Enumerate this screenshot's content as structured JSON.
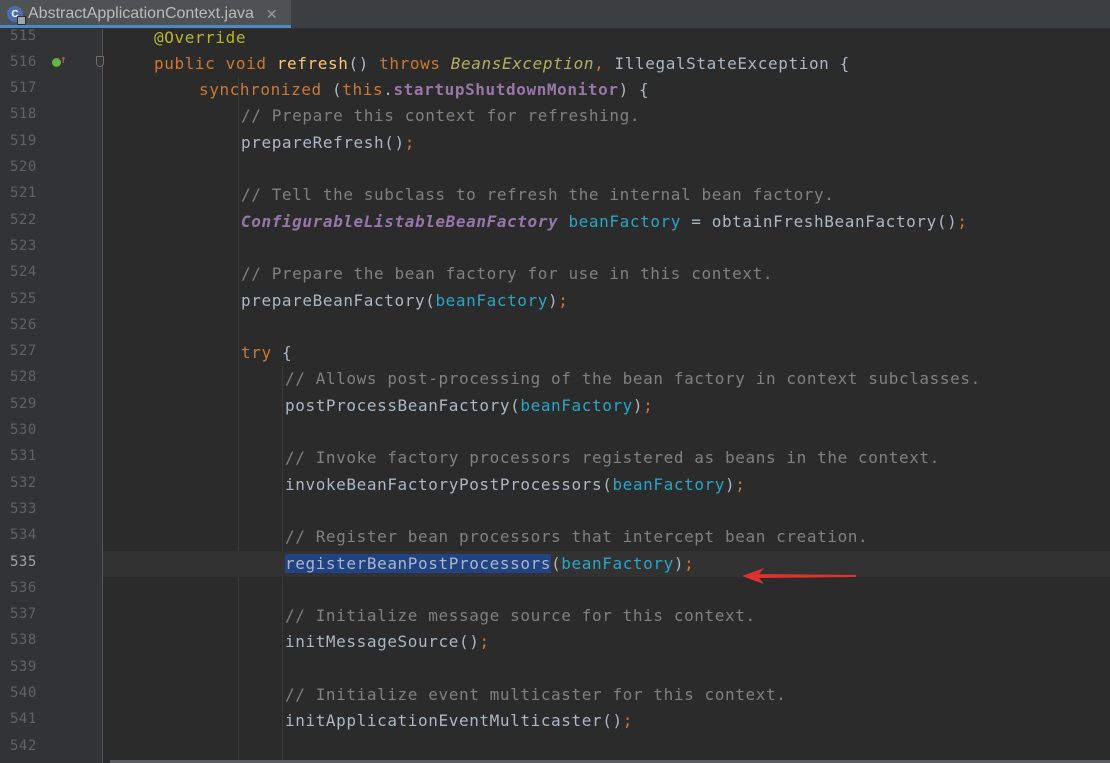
{
  "tab": {
    "title": "AbstractApplicationContext.java",
    "icon_letter": "C",
    "close": "✕"
  },
  "colors": {
    "background": "#2b2b2b",
    "gutter": "#313335",
    "keyword": "#cc7832",
    "annotation": "#bbb529",
    "method": "#ffc66d",
    "field": "#9876aa",
    "variable": "#29a5c5",
    "comment": "#808080",
    "selection": "#214283",
    "arrow": "#e0312f"
  },
  "gutter_icons": {
    "line_516": [
      "override-marker-icon",
      "override-arrow-icon",
      "fold-marker-icon"
    ]
  },
  "lines": [
    {
      "num": "515",
      "tokens": [
        {
          "t": "@Override",
          "c": "ann"
        }
      ]
    },
    {
      "num": "516",
      "tokens": [
        {
          "t": "public ",
          "c": "kw"
        },
        {
          "t": "void ",
          "c": "kw"
        },
        {
          "t": "refresh",
          "c": "fn"
        },
        {
          "t": "() "
        },
        {
          "t": "throws ",
          "c": "kw"
        },
        {
          "t": "BeansException",
          "c": "exc"
        },
        {
          "t": ", ",
          "c": "kw"
        },
        {
          "t": "IllegalStateException {"
        }
      ]
    },
    {
      "num": "517",
      "tokens": [
        {
          "t": "synchronized ",
          "c": "kw"
        },
        {
          "t": "("
        },
        {
          "t": "this",
          "c": "kw"
        },
        {
          "t": "."
        },
        {
          "t": "startupShutdownMonitor",
          "c": "fld"
        },
        {
          "t": ") {"
        }
      ]
    },
    {
      "num": "518",
      "tokens": [
        {
          "t": "// Prepare this context for refreshing.",
          "c": "cmt"
        }
      ]
    },
    {
      "num": "519",
      "tokens": [
        {
          "t": "prepareRefresh()"
        },
        {
          "t": ";",
          "c": "kw"
        }
      ]
    },
    {
      "num": "520",
      "tokens": []
    },
    {
      "num": "521",
      "tokens": [
        {
          "t": "// Tell the subclass to refresh the internal bean factory.",
          "c": "cmt"
        }
      ]
    },
    {
      "num": "522",
      "tokens": [
        {
          "t": "ConfigurableListableBeanFactory",
          "c": "typ"
        },
        {
          "t": " "
        },
        {
          "t": "beanFactory",
          "c": "var"
        },
        {
          "t": " = obtainFreshBeanFactory()"
        },
        {
          "t": ";",
          "c": "kw"
        }
      ]
    },
    {
      "num": "523",
      "tokens": []
    },
    {
      "num": "524",
      "tokens": [
        {
          "t": "// Prepare the bean factory for use in this context.",
          "c": "cmt"
        }
      ]
    },
    {
      "num": "525",
      "tokens": [
        {
          "t": "prepareBeanFactory("
        },
        {
          "t": "beanFactory",
          "c": "var"
        },
        {
          "t": ")"
        },
        {
          "t": ";",
          "c": "kw"
        }
      ]
    },
    {
      "num": "526",
      "tokens": []
    },
    {
      "num": "527",
      "tokens": [
        {
          "t": "try ",
          "c": "kw"
        },
        {
          "t": "{"
        }
      ]
    },
    {
      "num": "528",
      "tokens": [
        {
          "t": "// Allows post-processing of the bean factory in context subclasses.",
          "c": "cmt"
        }
      ]
    },
    {
      "num": "529",
      "tokens": [
        {
          "t": "postProcessBeanFactory("
        },
        {
          "t": "beanFactory",
          "c": "var"
        },
        {
          "t": ")"
        },
        {
          "t": ";",
          "c": "kw"
        }
      ]
    },
    {
      "num": "530",
      "tokens": []
    },
    {
      "num": "531",
      "tokens": [
        {
          "t": "// Invoke factory processors registered as beans in the context.",
          "c": "cmt"
        }
      ]
    },
    {
      "num": "532",
      "tokens": [
        {
          "t": "invokeBeanFactoryPostProcessors("
        },
        {
          "t": "beanFactory",
          "c": "var"
        },
        {
          "t": ")"
        },
        {
          "t": ";",
          "c": "kw"
        }
      ]
    },
    {
      "num": "533",
      "tokens": []
    },
    {
      "num": "534",
      "tokens": [
        {
          "t": "// Register bean processors that intercept bean creation.",
          "c": "cmt"
        }
      ]
    },
    {
      "num": "535",
      "current": true,
      "tokens": [
        {
          "t": "registerBeanPostProcessors",
          "c": "sel"
        },
        {
          "t": "("
        },
        {
          "t": "beanFactory",
          "c": "var"
        },
        {
          "t": ")"
        },
        {
          "t": ";",
          "c": "kw"
        }
      ]
    },
    {
      "num": "536",
      "tokens": []
    },
    {
      "num": "537",
      "tokens": [
        {
          "t": "// Initialize message source for this context.",
          "c": "cmt"
        }
      ]
    },
    {
      "num": "538",
      "tokens": [
        {
          "t": "initMessageSource()"
        },
        {
          "t": ";",
          "c": "kw"
        }
      ]
    },
    {
      "num": "539",
      "tokens": []
    },
    {
      "num": "540",
      "tokens": [
        {
          "t": "// Initialize event multicaster for this context.",
          "c": "cmt"
        }
      ]
    },
    {
      "num": "541",
      "tokens": [
        {
          "t": "initApplicationEventMulticaster()"
        },
        {
          "t": ";",
          "c": "kw"
        }
      ]
    },
    {
      "num": "542",
      "tokens": []
    }
  ]
}
